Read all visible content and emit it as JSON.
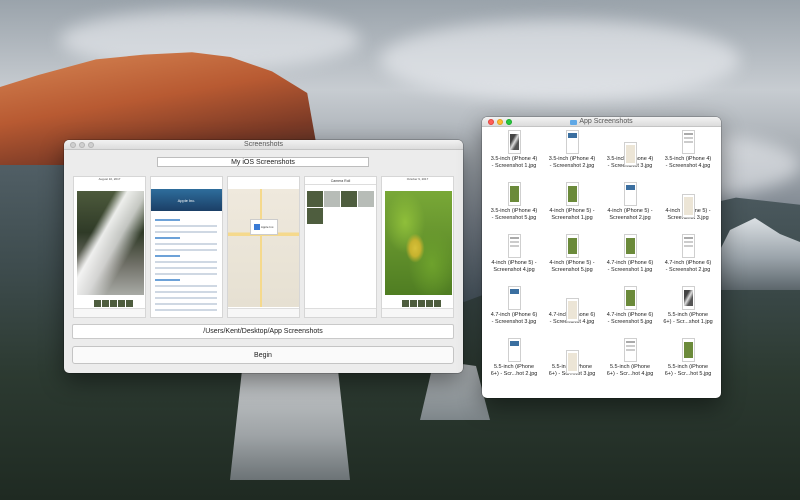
{
  "main_window": {
    "title": "Screenshots",
    "name_field_value": "My iOS Screenshots",
    "path_value": "/Users/Kent/Desktop/App Screenshots",
    "begin_label": "Begin",
    "previews": [
      {
        "type": "photo",
        "nav": "August 10, 2017"
      },
      {
        "type": "contact",
        "hero": "Apple Inc."
      },
      {
        "type": "map",
        "pin": "Apple Inc."
      },
      {
        "type": "roll",
        "nav": "Camera Roll"
      },
      {
        "type": "leaves",
        "nav": "October 9, 2017"
      }
    ]
  },
  "finder_window": {
    "title": "App Screenshots",
    "files": [
      {
        "line1": "3.5-inch (iPhone 4)",
        "line2": "- Screenshot 1.jpg",
        "icon": "water-photo"
      },
      {
        "line1": "3.5-inch (iPhone 4)",
        "line2": "- Screenshot 2.jpg",
        "icon": "web-page"
      },
      {
        "line1": "3.5-inch (iPhone 4)",
        "line2": "- Screenshot 3.jpg",
        "icon": "map-page"
      },
      {
        "line1": "3.5-inch (iPhone 4)",
        "line2": "- Screenshot 4.jpg",
        "icon": "list-page"
      },
      {
        "line1": "3.5-inch (iPhone 4)",
        "line2": "- Screenshot 5.jpg",
        "icon": "photo"
      },
      {
        "line1": "4-inch (iPhone 5) -",
        "line2": "Screenshot 1.jpg",
        "icon": "photo"
      },
      {
        "line1": "4-inch (iPhone 5) -",
        "line2": "Screenshot 2.jpg",
        "icon": "web-page"
      },
      {
        "line1": "4-inch (iPhone 5) -",
        "line2": "Screenshot 3.jpg",
        "icon": "map-page"
      },
      {
        "line1": "4-inch (iPhone 5) -",
        "line2": "Screenshot 4.jpg",
        "icon": "list-page"
      },
      {
        "line1": "4-inch (iPhone 5) -",
        "line2": "Screenshot 5.jpg",
        "icon": "photo"
      },
      {
        "line1": "4.7-inch (iPhone 6)",
        "line2": "- Screenshot 1.jpg",
        "icon": "photo"
      },
      {
        "line1": "4.7-inch (iPhone 6)",
        "line2": "- Screenshot 2.jpg",
        "icon": "list-page"
      },
      {
        "line1": "4.7-inch (iPhone 6)",
        "line2": "- Screenshot 3.jpg",
        "icon": "web-page"
      },
      {
        "line1": "4.7-inch (iPhone 6)",
        "line2": "- Screenshot 4.jpg",
        "icon": "map-page"
      },
      {
        "line1": "4.7-inch (iPhone 6)",
        "line2": "- Screenshot 5.jpg",
        "icon": "photo"
      },
      {
        "line1": "5.5-inch (iPhone",
        "line2": "6+) - Scr...shot 1.jpg",
        "icon": "water-photo"
      },
      {
        "line1": "5.5-inch (iPhone",
        "line2": "6+) - Scr...hot 2.jpg",
        "icon": "web-page"
      },
      {
        "line1": "5.5-inch (iPhone",
        "line2": "6+) - Scr...hot 3.jpg",
        "icon": "map-page"
      },
      {
        "line1": "5.5-inch (iPhone",
        "line2": "6+) - Scr...hot 4.jpg",
        "icon": "list-page"
      },
      {
        "line1": "5.5-inch (iPhone",
        "line2": "6+) - Scr...hot 5.jpg",
        "icon": "photo"
      }
    ]
  }
}
